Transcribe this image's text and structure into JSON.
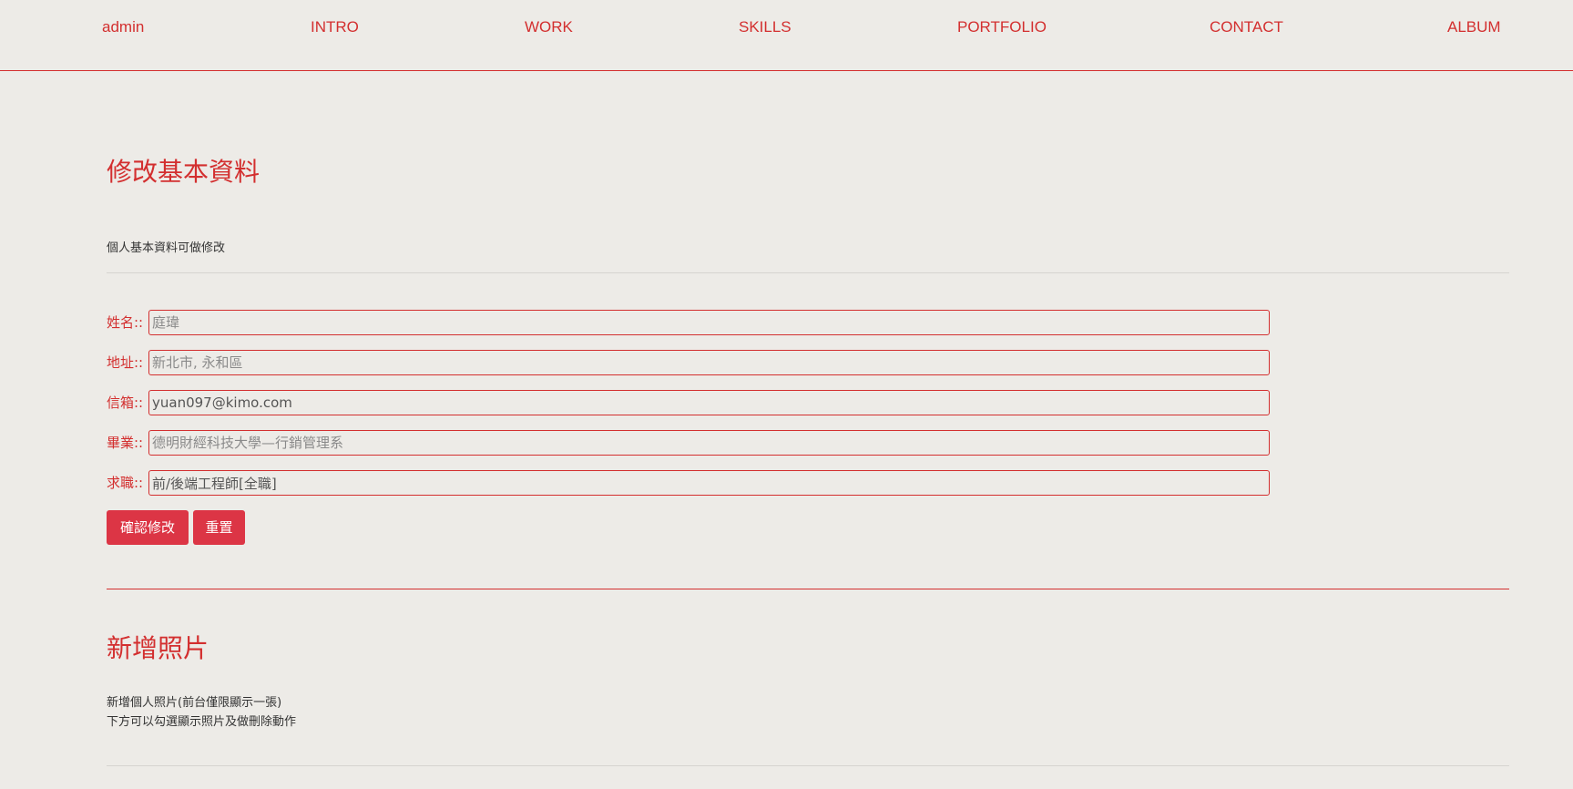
{
  "nav": {
    "items": [
      {
        "label": "admin"
      },
      {
        "label": "INTRO"
      },
      {
        "label": "WORK"
      },
      {
        "label": "SKILLS"
      },
      {
        "label": "PORTFOLIO"
      },
      {
        "label": "CONTACT"
      },
      {
        "label": "ALBUM"
      }
    ]
  },
  "profile_section": {
    "title": "修改基本資料",
    "description": "個人基本資料可做修改",
    "fields": [
      {
        "label": "姓名::",
        "value": "",
        "placeholder": "庭瑋"
      },
      {
        "label": "地址::",
        "value": "",
        "placeholder": "新北市, 永和區"
      },
      {
        "label": "信箱::",
        "value": "yuan097@kimo.com",
        "placeholder": ""
      },
      {
        "label": "畢業::",
        "value": "",
        "placeholder": "德明財經科技大學—行銷管理系"
      },
      {
        "label": "求職::",
        "value": "前/後端工程師[全職]",
        "placeholder": ""
      }
    ],
    "confirm_button": "確認修改",
    "reset_button": "重置"
  },
  "photo_section": {
    "title": "新增照片",
    "description_line1": "新增個人照片(前台僅限顯示一張)",
    "description_line2": "下方可以勾選顯示照片及做刪除動作"
  },
  "colors": {
    "accent": "#d32f2f",
    "button": "#dc3545",
    "background": "#edebe7"
  }
}
